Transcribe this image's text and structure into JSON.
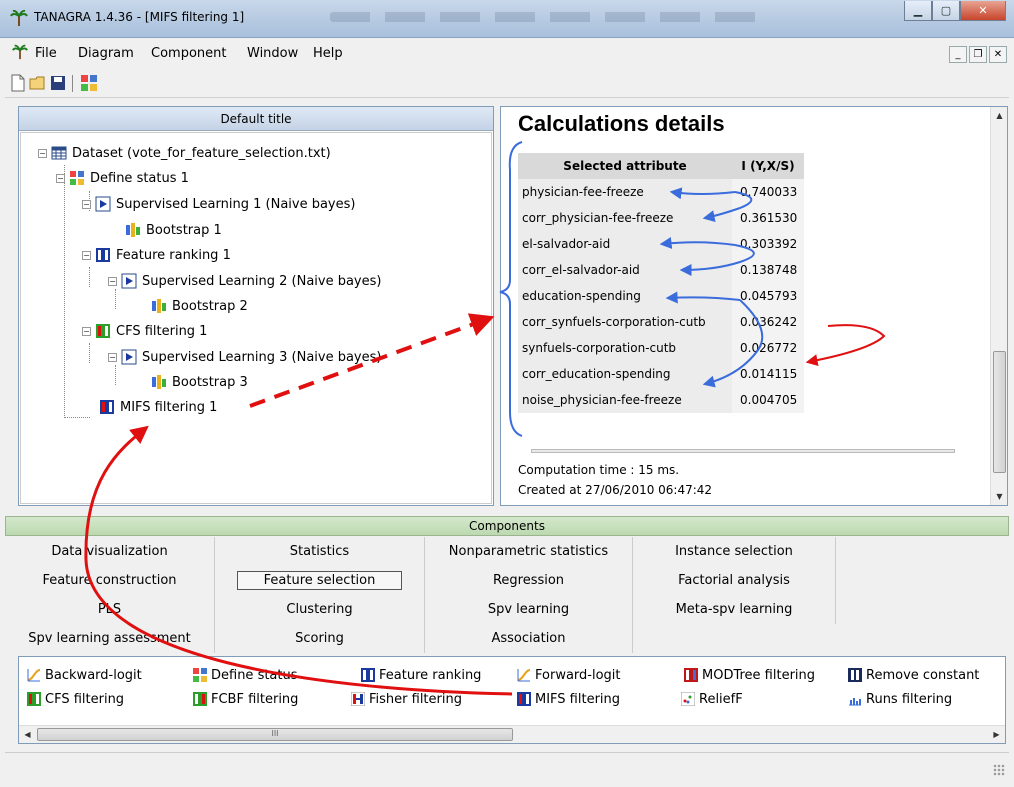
{
  "window": {
    "title": "TANAGRA 1.4.36 - [MIFS filtering 1]"
  },
  "menu": [
    "File",
    "Diagram",
    "Component",
    "Window",
    "Help"
  ],
  "tree": {
    "header": "Default title",
    "nodes": [
      "Dataset (vote_for_feature_selection.txt)",
      "Define status 1",
      "Supervised Learning 1 (Naive bayes)",
      "Bootstrap 1",
      "Feature ranking 1",
      "Supervised Learning 2 (Naive bayes)",
      "Bootstrap 2",
      "CFS filtering 1",
      "Supervised Learning 3 (Naive bayes)",
      "Bootstrap 3",
      "MIFS filtering 1"
    ]
  },
  "calc": {
    "title": "Calculations details",
    "columns": [
      "Selected attribute",
      "I (Y,X/S)"
    ],
    "rows": [
      [
        "physician-fee-freeze",
        "0.740033"
      ],
      [
        "corr_physician-fee-freeze",
        "0.361530"
      ],
      [
        "el-salvador-aid",
        "0.303392"
      ],
      [
        "corr_el-salvador-aid",
        "0.138748"
      ],
      [
        "education-spending",
        "0.045793"
      ],
      [
        "corr_synfuels-corporation-cutb",
        "0.036242"
      ],
      [
        "synfuels-corporation-cutb",
        "0.026772"
      ],
      [
        "corr_education-spending",
        "0.014115"
      ],
      [
        "noise_physician-fee-freeze",
        "0.004705"
      ]
    ],
    "computation_time": "Computation time : 15 ms.",
    "created_at": "Created at 27/06/2010 06:47:42"
  },
  "components": {
    "header": "Components",
    "tabs": [
      [
        "Data visualization",
        "Statistics",
        "Nonparametric statistics",
        "Instance selection"
      ],
      [
        "Feature construction",
        "Feature selection",
        "Regression",
        "Factorial analysis"
      ],
      [
        "PLS",
        "Clustering",
        "Spv learning",
        "Meta-spv learning"
      ],
      [
        "Spv learning assessment",
        "Scoring",
        "Association",
        ""
      ]
    ],
    "active_tab": "Feature selection"
  },
  "tools": [
    "Backward-logit",
    "Define status",
    "Feature ranking",
    "Forward-logit",
    "MODTree filtering",
    "Remove constant",
    "CFS filtering",
    "FCBF filtering",
    "Fisher filtering",
    "MIFS filtering",
    "ReliefF",
    "Runs filtering"
  ],
  "scroll_thumb_glyph": "III",
  "annotation_colors": {
    "blue": "#3a6cdc",
    "red": "#e01010"
  }
}
